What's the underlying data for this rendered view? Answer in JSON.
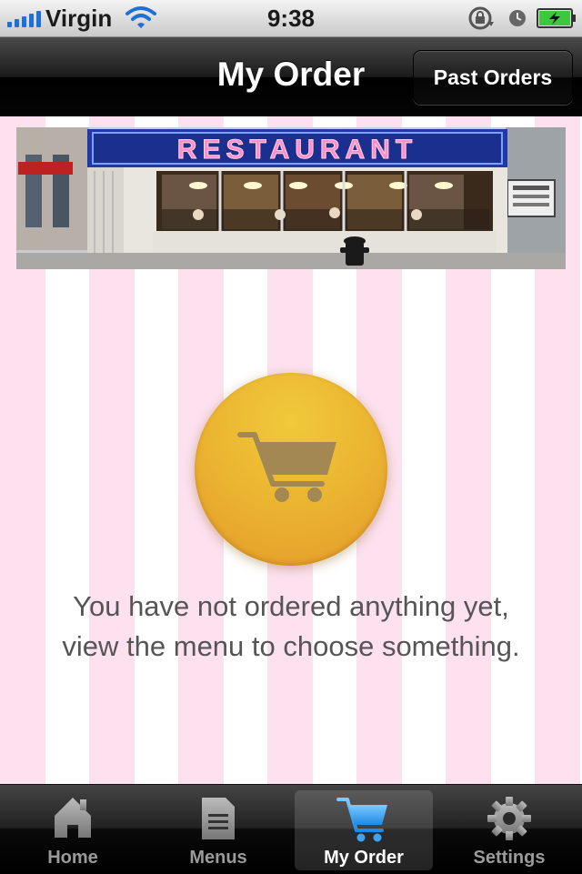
{
  "status_bar": {
    "carrier": "Virgin",
    "time": "9:38"
  },
  "nav_bar": {
    "title": "My Order",
    "past_orders_label": "Past Orders"
  },
  "banner": {
    "sign_text": "RESTAURANT"
  },
  "empty_state": {
    "icon": "shopping-cart-icon",
    "line1": "You have not ordered anything yet,",
    "line2": "view the menu to choose something."
  },
  "tab_bar": {
    "items": [
      {
        "label": "Home",
        "icon": "home-icon",
        "active": false
      },
      {
        "label": "Menus",
        "icon": "document-icon",
        "active": false
      },
      {
        "label": "My Order",
        "icon": "cart-icon",
        "active": true
      },
      {
        "label": "Settings",
        "icon": "gear-icon",
        "active": false
      }
    ]
  },
  "colors": {
    "accent_blue": "#3da4f5",
    "cart_gold": "#ebb631",
    "stripe_pink": "#fde1ef"
  }
}
